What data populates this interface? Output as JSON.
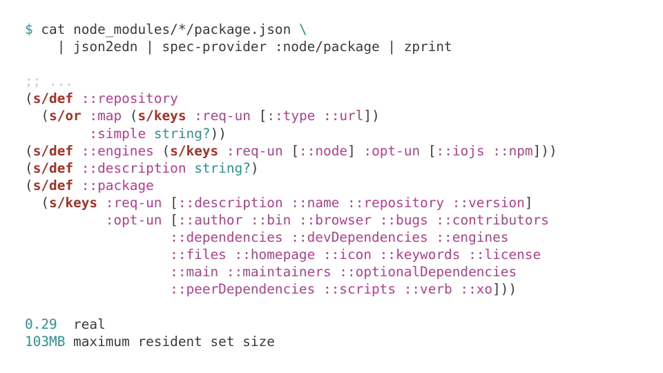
{
  "terminal": {
    "title": "spec-provider terminal session",
    "background_color": "#ffffff",
    "colors": {
      "prompt": "#2c9392",
      "plain_text": "#3a3a3a",
      "comment": "#c9c9c9",
      "macro": "#a03228",
      "keyword": "#b0418f",
      "predicate": "#2c9392",
      "number": "#2c9392",
      "punctuation": "#3a3a3a"
    },
    "prompt_symbol": "$",
    "command": {
      "line1": "cat node_modules/*/package.json",
      "line1_continuation": "\\",
      "line2_indent": "    ",
      "line2": "| json2edn | spec-provider :node/package | zprint"
    },
    "output": {
      "comment": ";; ...",
      "specs": [
        {
          "id": "repository",
          "segments": [
            {
              "t": "(",
              "c": "punct"
            },
            {
              "t": "s/def",
              "c": "macro"
            },
            {
              "t": " ",
              "c": "plain"
            },
            {
              "t": "::repository",
              "c": "kw"
            }
          ]
        },
        {
          "id": "repository-body-1",
          "segments": [
            {
              "t": "  (",
              "c": "punct"
            },
            {
              "t": "s/or",
              "c": "macro"
            },
            {
              "t": " ",
              "c": "plain"
            },
            {
              "t": ":map",
              "c": "kw"
            },
            {
              "t": " (",
              "c": "punct"
            },
            {
              "t": "s/keys",
              "c": "macro"
            },
            {
              "t": " ",
              "c": "plain"
            },
            {
              "t": ":req-un",
              "c": "kw"
            },
            {
              "t": " [",
              "c": "punct"
            },
            {
              "t": "::type ::url",
              "c": "kw"
            },
            {
              "t": "])",
              "c": "punct"
            }
          ]
        },
        {
          "id": "repository-body-2",
          "segments": [
            {
              "t": "        ",
              "c": "plain"
            },
            {
              "t": ":simple",
              "c": "kw"
            },
            {
              "t": " ",
              "c": "plain"
            },
            {
              "t": "string?",
              "c": "pred"
            },
            {
              "t": "))",
              "c": "punct"
            }
          ]
        },
        {
          "id": "engines",
          "segments": [
            {
              "t": "(",
              "c": "punct"
            },
            {
              "t": "s/def",
              "c": "macro"
            },
            {
              "t": " ",
              "c": "plain"
            },
            {
              "t": "::engines",
              "c": "kw"
            },
            {
              "t": " (",
              "c": "punct"
            },
            {
              "t": "s/keys",
              "c": "macro"
            },
            {
              "t": " ",
              "c": "plain"
            },
            {
              "t": ":req-un",
              "c": "kw"
            },
            {
              "t": " [",
              "c": "punct"
            },
            {
              "t": "::node",
              "c": "kw"
            },
            {
              "t": "] ",
              "c": "punct"
            },
            {
              "t": ":opt-un",
              "c": "kw"
            },
            {
              "t": " [",
              "c": "punct"
            },
            {
              "t": "::iojs ::npm",
              "c": "kw"
            },
            {
              "t": "]))",
              "c": "punct"
            }
          ]
        },
        {
          "id": "description",
          "segments": [
            {
              "t": "(",
              "c": "punct"
            },
            {
              "t": "s/def",
              "c": "macro"
            },
            {
              "t": " ",
              "c": "plain"
            },
            {
              "t": "::description",
              "c": "kw"
            },
            {
              "t": " ",
              "c": "plain"
            },
            {
              "t": "string?",
              "c": "pred"
            },
            {
              "t": ")",
              "c": "punct"
            }
          ]
        },
        {
          "id": "package",
          "segments": [
            {
              "t": "(",
              "c": "punct"
            },
            {
              "t": "s/def",
              "c": "macro"
            },
            {
              "t": " ",
              "c": "plain"
            },
            {
              "t": "::package",
              "c": "kw"
            }
          ]
        },
        {
          "id": "package-req-un",
          "segments": [
            {
              "t": "  (",
              "c": "punct"
            },
            {
              "t": "s/keys",
              "c": "macro"
            },
            {
              "t": " ",
              "c": "plain"
            },
            {
              "t": ":req-un",
              "c": "kw"
            },
            {
              "t": " [",
              "c": "punct"
            },
            {
              "t": "::description ::name ::repository ::version",
              "c": "kw"
            },
            {
              "t": "]",
              "c": "punct"
            }
          ]
        },
        {
          "id": "package-opt-un-1",
          "segments": [
            {
              "t": "          ",
              "c": "plain"
            },
            {
              "t": ":opt-un",
              "c": "kw"
            },
            {
              "t": " [",
              "c": "punct"
            },
            {
              "t": "::author ::bin ::browser ::bugs ::contributors",
              "c": "kw"
            }
          ]
        },
        {
          "id": "package-opt-un-2",
          "segments": [
            {
              "t": "                  ",
              "c": "plain"
            },
            {
              "t": "::dependencies ::devDependencies ::engines",
              "c": "kw"
            }
          ]
        },
        {
          "id": "package-opt-un-3",
          "segments": [
            {
              "t": "                  ",
              "c": "plain"
            },
            {
              "t": "::files ::homepage ::icon ::keywords ::license",
              "c": "kw"
            }
          ]
        },
        {
          "id": "package-opt-un-4",
          "segments": [
            {
              "t": "                  ",
              "c": "plain"
            },
            {
              "t": "::main ::maintainers ::optionalDependencies",
              "c": "kw"
            }
          ]
        },
        {
          "id": "package-opt-un-5",
          "segments": [
            {
              "t": "                  ",
              "c": "plain"
            },
            {
              "t": "::peerDependencies ::scripts ::verb ::xo",
              "c": "kw"
            },
            {
              "t": "]))",
              "c": "punct"
            }
          ]
        }
      ],
      "timing": [
        {
          "value": "0.29 ",
          "label": " real"
        },
        {
          "value": "103MB",
          "label": " maximum resident set size"
        }
      ]
    }
  }
}
